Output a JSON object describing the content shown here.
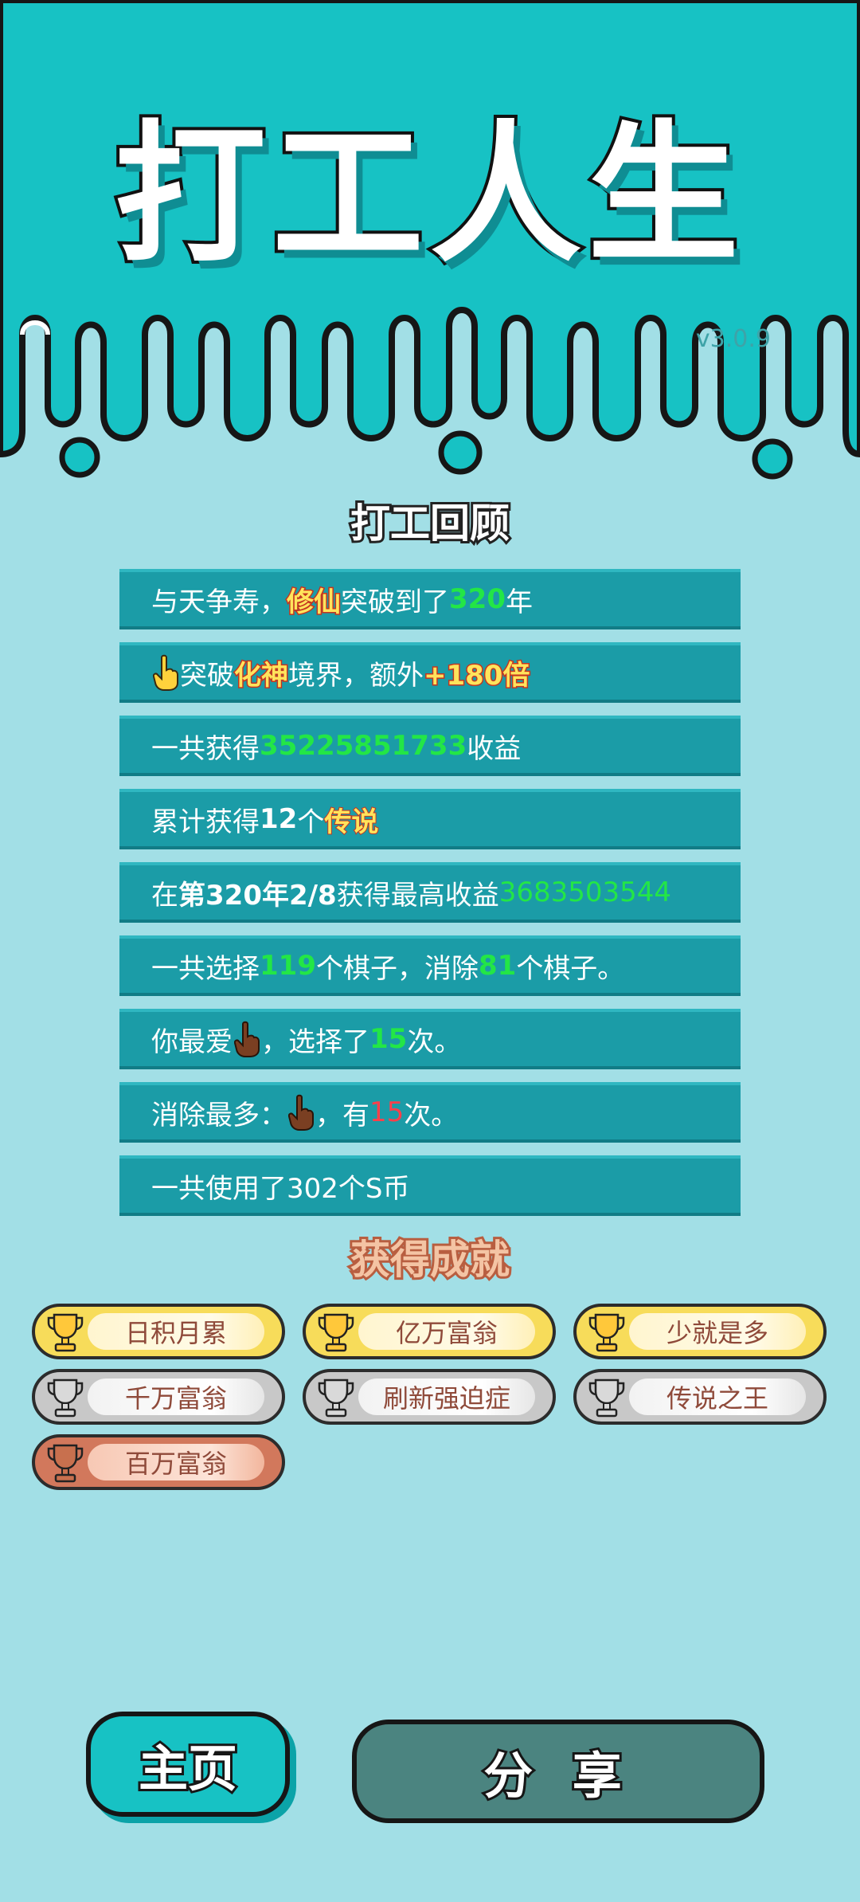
{
  "app": {
    "title": "打工人生",
    "version": "v3.0.9"
  },
  "review": {
    "title": "打工回顾",
    "rows": [
      {
        "parts": [
          "与天争寿，",
          "修仙",
          "突破到了",
          "320",
          "年"
        ]
      },
      {
        "parts": [
          "突破",
          "化神",
          "境界，额外",
          "+180倍"
        ]
      },
      {
        "parts": [
          "一共获得",
          "35225851733",
          "收益"
        ]
      },
      {
        "parts": [
          "累计获得",
          "12",
          "个",
          "传说"
        ]
      },
      {
        "parts": [
          "在 ",
          "第320年2/8",
          " 获得最高收益",
          "3683503544"
        ]
      },
      {
        "parts": [
          "一共选择",
          "119",
          "个棋子，消除",
          "81",
          "个棋子。"
        ]
      },
      {
        "parts": [
          "你最爱",
          "，选择了",
          "15",
          "次。"
        ]
      },
      {
        "parts": [
          "消除最多：",
          "，有",
          "15",
          "次。"
        ]
      },
      {
        "parts": [
          "一共使用了302个S币"
        ]
      }
    ]
  },
  "achievements": {
    "title": "获得成就",
    "items": [
      {
        "label": "日积月累",
        "tier": "gold"
      },
      {
        "label": "亿万富翁",
        "tier": "gold"
      },
      {
        "label": "少就是多",
        "tier": "gold"
      },
      {
        "label": "千万富翁",
        "tier": "silver"
      },
      {
        "label": "刷新强迫症",
        "tier": "silver"
      },
      {
        "label": "传说之王",
        "tier": "silver"
      },
      {
        "label": "百万富翁",
        "tier": "bronze"
      }
    ]
  },
  "buttons": {
    "home": "主页",
    "share": "分 享"
  },
  "colors": {
    "background": "#a2dfe6",
    "header": "#17c2c4",
    "row": "#1b9ca7",
    "green": "#23e646",
    "gold": "#ffe45c",
    "share_button": "#4b8480"
  }
}
